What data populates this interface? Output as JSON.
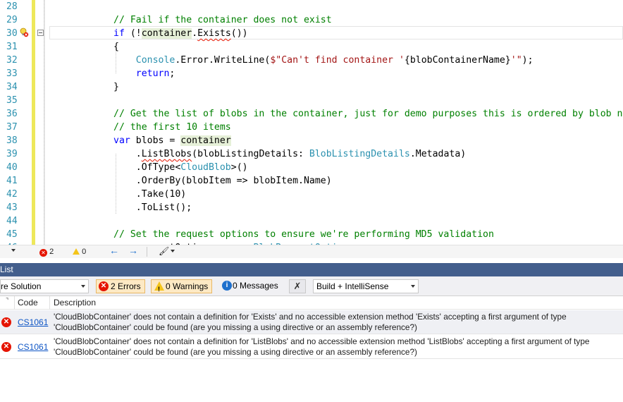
{
  "editor": {
    "lines": [
      {
        "n": "28",
        "html": ""
      },
      {
        "n": "29",
        "html": "<span class=\"cm\">// Fail if the container does not exist</span>"
      },
      {
        "n": "30",
        "html": "<span class=\"kw\">if</span> (!<span class=\"hl\">container</span>.<span class=\"squig\">Exists</span>())"
      },
      {
        "n": "31",
        "html": "{"
      },
      {
        "n": "32",
        "html": "    <span class=\"ty\">Console</span>.Error.WriteLine(<span class=\"st\">$\"Can't find container '</span>{blobContainerName}<span class=\"st\">'\"</span>);"
      },
      {
        "n": "33",
        "html": "    <span class=\"kw\">return</span>;"
      },
      {
        "n": "34",
        "html": "}"
      },
      {
        "n": "35",
        "html": ""
      },
      {
        "n": "36",
        "html": "<span class=\"cm\">// Get the list of blobs in the container, just for demo purposes this is ordered by blob name, and it only returns</span>"
      },
      {
        "n": "37",
        "html": "<span class=\"cm\">// the first 10 items</span>"
      },
      {
        "n": "38",
        "html": "<span class=\"kw\">var</span> blobs = <span class=\"hl\">container</span>"
      },
      {
        "n": "39",
        "html": "    .<span class=\"squig\">ListBlobs</span>(blobListingDetails: <span class=\"ty\">BlobListingDetails</span>.Metadata)"
      },
      {
        "n": "40",
        "html": "    .OfType&lt;<span class=\"ty\">CloudBlob</span>&gt;()"
      },
      {
        "n": "41",
        "html": "    .OrderBy(blobItem =&gt; blobItem.Name)"
      },
      {
        "n": "42",
        "html": "    .Take(10)"
      },
      {
        "n": "43",
        "html": "    .ToList();"
      },
      {
        "n": "44",
        "html": ""
      },
      {
        "n": "45",
        "html": "<span class=\"cm\">// Set the request options to ensure we're performing MD5 validation</span>"
      },
      {
        "n": "46",
        "html": "<span class=\"kw\">var</span> requestOptions = <span class=\"kw\">new</span> <span class=\"ty\">BlobRequestOptions</span>"
      }
    ]
  },
  "editor_status": {
    "errors": "2",
    "warnings": "0"
  },
  "error_list": {
    "title": "List",
    "scope": "re Solution",
    "errors_btn": "2 Errors",
    "warnings_btn": "0 Warnings",
    "messages_btn": "0 Messages",
    "build_filter": "Build + IntelliSense",
    "col_code": "Code",
    "col_desc": "Description",
    "rows": [
      {
        "code": "CS1061",
        "desc1": "'CloudBlobContainer' does not contain a definition for 'Exists' and no accessible extension method 'Exists' accepting a first argument of type",
        "desc2": "'CloudBlobContainer' could be found (are you missing a using directive or an assembly reference?)"
      },
      {
        "code": "CS1061",
        "desc1": "'CloudBlobContainer' does not contain a definition for 'ListBlobs' and no accessible extension method 'ListBlobs' accepting a first argument of type",
        "desc2": "'CloudBlobContainer' could be found (are you missing a using directive or an assembly reference?)"
      }
    ]
  },
  "colors": {
    "accent_header": "#435e8c",
    "error_red": "#e51400",
    "comment_green": "#008000",
    "keyword_blue": "#0000ff"
  }
}
